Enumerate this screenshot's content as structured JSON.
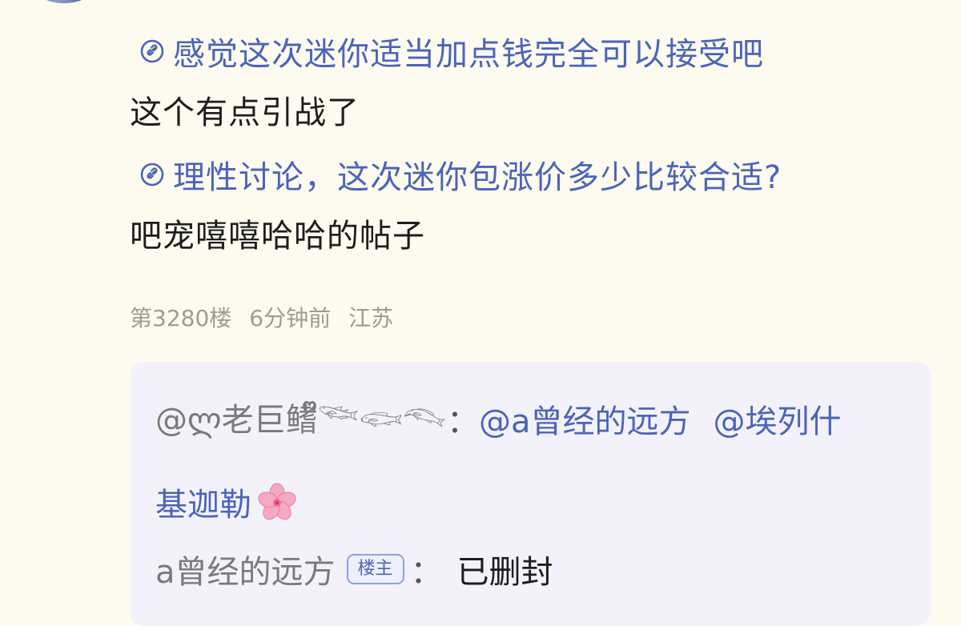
{
  "post": {
    "link1": "感觉这次迷你适当加点钱完全可以接受吧",
    "text1": "这个有点引战了",
    "link2": "理性讨论，这次迷你包涨价多少比较合适?",
    "text2": "吧宠嘻嘻哈哈的帖子"
  },
  "meta": {
    "floor": "第3280楼",
    "time": "6分钟前",
    "location": "江苏"
  },
  "reply": {
    "line1_author": "@ლ老巨鳍ᩚᩚᩚᩚᩚ𓆝𓆟𓆞",
    "line1_colon": "：",
    "mention1": "@a曾经的远方",
    "mention2_part1": "@埃列什",
    "mention2_part2": "基迦勒",
    "blossom_icon": "cherry-blossom-icon",
    "author2": "a曾经的远方",
    "op_badge": "楼主",
    "colon2": "：",
    "content": "已删封"
  },
  "colors": {
    "link": "#4b64b8",
    "background": "#fdfaef",
    "reply_bg": "#f3f2fb"
  }
}
